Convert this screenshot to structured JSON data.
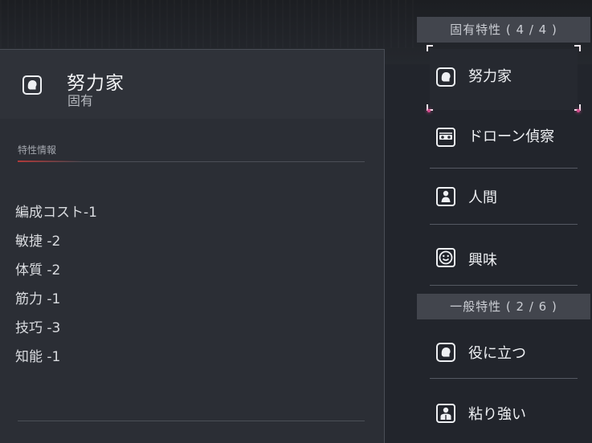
{
  "detail": {
    "title": "努力家",
    "subtitle": "固有",
    "icon": "head-shield-icon",
    "section_label": "特性情報",
    "effects": [
      "編成コスト-1",
      "敏捷 -2",
      "体質 -2",
      "筋力 -1",
      "技巧 -3",
      "知能 -1"
    ]
  },
  "categories": {
    "innate": {
      "label": "固有特性 ( 4 / 4 )"
    },
    "general": {
      "label": "一般特性 ( 2 / 6 )"
    }
  },
  "traits": {
    "innate": [
      {
        "label": "努力家",
        "icon": "head-shield-icon"
      },
      {
        "label": "ドローン偵察",
        "icon": "drone-mask-icon"
      },
      {
        "label": "人間",
        "icon": "person-icon"
      },
      {
        "label": "興味",
        "icon": "smiley-icon"
      }
    ],
    "general": [
      {
        "label": "役に立つ",
        "icon": "head-shield-icon"
      },
      {
        "label": "粘り強い",
        "icon": "person-bust-icon"
      }
    ]
  },
  "colors": {
    "accent": "#b03a3a",
    "selection_corner": "#f1e7ec",
    "glow": "#ff5aa8"
  }
}
